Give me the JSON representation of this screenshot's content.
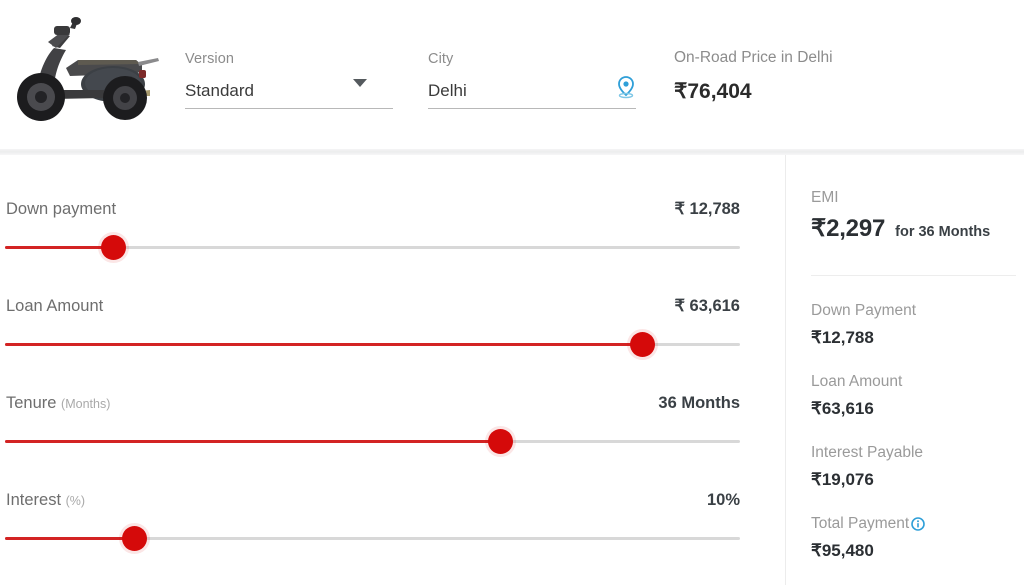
{
  "header": {
    "vehicle_image_alt": "scooter-side-profile",
    "version": {
      "label": "Version",
      "value": "Standard",
      "icon": "chevron-down-icon"
    },
    "city": {
      "label": "City",
      "value": "Delhi",
      "icon": "location-pin-icon"
    },
    "price": {
      "label": "On-Road Price in Delhi",
      "value": "₹76,404"
    }
  },
  "sliders": [
    {
      "name": "down-payment",
      "label": "Down payment",
      "unit": "",
      "value": "₹ 12,788",
      "fill_percent": 14.7,
      "thumb_percent": 14.7
    },
    {
      "name": "loan-amount",
      "label": "Loan Amount",
      "unit": "",
      "value": "₹ 63,616",
      "fill_percent": 86.7,
      "thumb_percent": 86.7
    },
    {
      "name": "tenure",
      "label": "Tenure",
      "unit": "(Months)",
      "value": "36 Months",
      "fill_percent": 67.3,
      "thumb_percent": 67.3
    },
    {
      "name": "interest",
      "label": "Interest",
      "unit": "(%)",
      "value": "10%",
      "fill_percent": 17.5,
      "thumb_percent": 17.5
    }
  ],
  "summary": {
    "emi_label": "EMI",
    "emi_amount": "₹2,297",
    "emi_term": "for 36 Months",
    "items": [
      {
        "label": "Down Payment",
        "value": "₹12,788",
        "info": false
      },
      {
        "label": "Loan Amount",
        "value": "₹63,616",
        "info": false
      },
      {
        "label": "Interest Payable",
        "value": "₹19,076",
        "info": false
      },
      {
        "label": "Total Payment",
        "value": "₹95,480",
        "info": true
      }
    ]
  },
  "colors": {
    "slider_accent": "#d50a0a",
    "track": "#d8d8d8",
    "link_blue": "#2f9fd8",
    "label_gray": "#8c8c8c",
    "value_dark": "#2b2f33"
  }
}
